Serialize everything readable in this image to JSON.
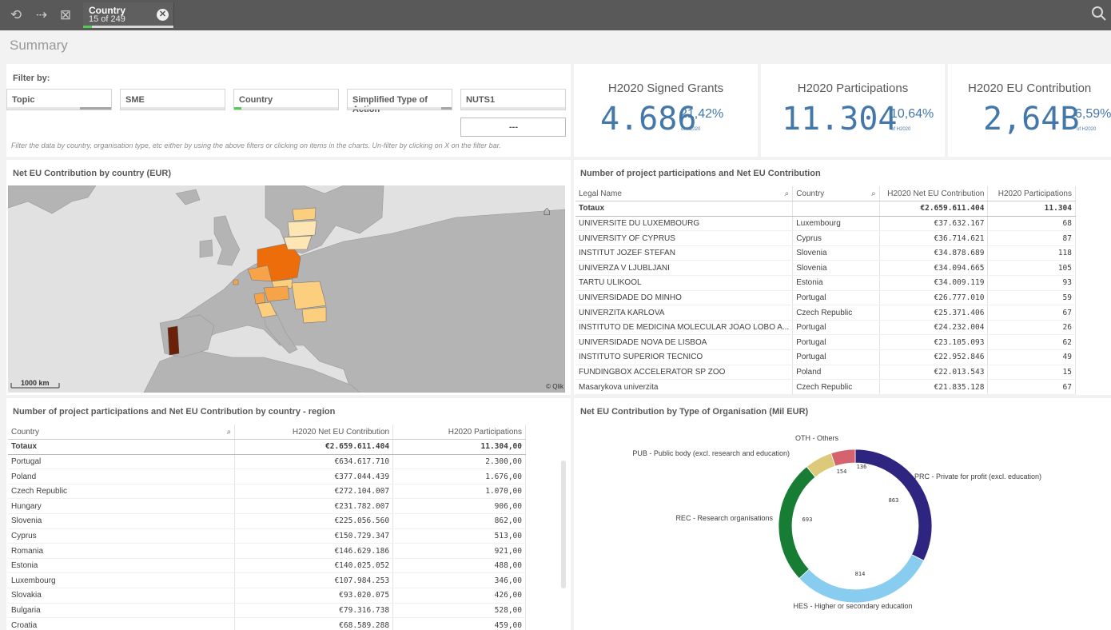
{
  "toolbar": {
    "selection": {
      "field": "Country",
      "count": "15 of 249"
    }
  },
  "sheet": {
    "title": "Summary"
  },
  "filters": {
    "title": "Filter by:",
    "items": [
      {
        "label": "Topic"
      },
      {
        "label": "SME"
      },
      {
        "label": "Country"
      },
      {
        "label": "Simplified Type of Action"
      },
      {
        "label": "NUTS1"
      }
    ],
    "more_label": "---",
    "hint": "Filter the data by country, organisation type, etc either by using the above filters or clicking on items in the charts. Un-filter by clicking on X on the filter bar."
  },
  "kpis": [
    {
      "title": "H2020 Signed Grants",
      "value": "4.686",
      "pct": "21,42%",
      "of": "of H2020"
    },
    {
      "title": "H2020 Participations",
      "value": "11.304",
      "pct": "10,64%",
      "of": "of H2020"
    },
    {
      "title": "H2020 EU Contribution",
      "value": "2,64B",
      "pct": "6,59%",
      "of": "of H2020"
    }
  ],
  "map": {
    "title": "Net EU Contribution by country (EUR)",
    "scale_label": "1000 km",
    "credit": "© Qlik",
    "colors": {
      "sea": "#e1e1e1",
      "land": "#b4b4b4",
      "border": "#8c8c8c",
      "dark": "#6b2008",
      "orange": "#ee6d0b",
      "mid": "#f6a34a",
      "light": "#fbcf7e",
      "pale": "#fde6b3"
    }
  },
  "participations_table": {
    "title": "Number of project participations and Net EU Contribution",
    "columns": [
      "Legal Name",
      "Country",
      "H2020 Net EU Contribution",
      "H2020 Participations"
    ],
    "totals": {
      "label": "Totaux",
      "contribution": "€2.659.611.404",
      "participations": "11.304"
    },
    "rows": [
      {
        "name": "UNIVERSITE DU LUXEMBOURG",
        "country": "Luxembourg",
        "contribution": "€37.632.167",
        "participations": "68"
      },
      {
        "name": "UNIVERSITY OF CYPRUS",
        "country": "Cyprus",
        "contribution": "€36.714.621",
        "participations": "87"
      },
      {
        "name": "INSTITUT JOZEF STEFAN",
        "country": "Slovenia",
        "contribution": "€34.878.689",
        "participations": "118"
      },
      {
        "name": "UNIVERZA V LJUBLJANI",
        "country": "Slovenia",
        "contribution": "€34.094.665",
        "participations": "105"
      },
      {
        "name": "TARTU ULIKOOL",
        "country": "Estonia",
        "contribution": "€34.009.119",
        "participations": "93"
      },
      {
        "name": "UNIVERSIDADE DO MINHO",
        "country": "Portugal",
        "contribution": "€26.777.010",
        "participations": "59"
      },
      {
        "name": "UNIVERZITA KARLOVA",
        "country": "Czech Republic",
        "contribution": "€25.371.406",
        "participations": "67"
      },
      {
        "name": "INSTITUTO DE MEDICINA MOLECULAR JOAO LOBO A...",
        "country": "Portugal",
        "contribution": "€24.232.004",
        "participations": "26"
      },
      {
        "name": "UNIVERSIDADE NOVA DE LISBOA",
        "country": "Portugal",
        "contribution": "€23.105.093",
        "participations": "62"
      },
      {
        "name": "INSTITUTO SUPERIOR TECNICO",
        "country": "Portugal",
        "contribution": "€22.952.846",
        "participations": "49"
      },
      {
        "name": "FUNDINGBOX ACCELERATOR SP ZOO",
        "country": "Poland",
        "contribution": "€22.013.543",
        "participations": "15"
      },
      {
        "name": "Masarykova univerzita",
        "country": "Czech Republic",
        "contribution": "€21.835.128",
        "participations": "67"
      }
    ]
  },
  "country_table": {
    "title": "Number of project participations and Net EU Contribution by country - region",
    "columns": [
      "Country",
      "H2020 Net EU Contribution",
      "H2020 Participations"
    ],
    "totals": {
      "label": "Totaux",
      "contribution": "€2.659.611.404",
      "participations": "11.304,00"
    },
    "rows": [
      {
        "country": "Portugal",
        "contribution": "€634.617.710",
        "participations": "2.300,00"
      },
      {
        "country": "Poland",
        "contribution": "€377.044.439",
        "participations": "1.676,00"
      },
      {
        "country": "Czech Republic",
        "contribution": "€272.104.007",
        "participations": "1.070,00"
      },
      {
        "country": "Hungary",
        "contribution": "€231.782.007",
        "participations": "906,00"
      },
      {
        "country": "Slovenia",
        "contribution": "€225.056.560",
        "participations": "862,00"
      },
      {
        "country": "Cyprus",
        "contribution": "€150.729.347",
        "participations": "513,00"
      },
      {
        "country": "Romania",
        "contribution": "€146.629.186",
        "participations": "921,00"
      },
      {
        "country": "Estonia",
        "contribution": "€140.025.052",
        "participations": "488,00"
      },
      {
        "country": "Luxembourg",
        "contribution": "€107.984.253",
        "participations": "346,00"
      },
      {
        "country": "Slovakia",
        "contribution": "€93.020.075",
        "participations": "426,00"
      },
      {
        "country": "Bulgaria",
        "contribution": "€79.316.738",
        "participations": "528,00"
      },
      {
        "country": "Croatia",
        "contribution": "€68.589.288",
        "participations": "459,00"
      }
    ]
  },
  "chart_data": {
    "type": "pie",
    "title": "Net EU Contribution by Type of Organisation (Mil EUR)",
    "categories": [
      "PRC - Private for profit (excl. education)",
      "HES - Higher or secondary education",
      "REC - Research organisations",
      "PUB - Public body (excl. research and education)",
      "OTH - Others"
    ],
    "values": [
      863,
      814,
      693,
      154,
      136
    ],
    "colors": [
      "#2e2580",
      "#88cdf0",
      "#177d34",
      "#dcc97a",
      "#d4636e"
    ],
    "donut": true
  }
}
